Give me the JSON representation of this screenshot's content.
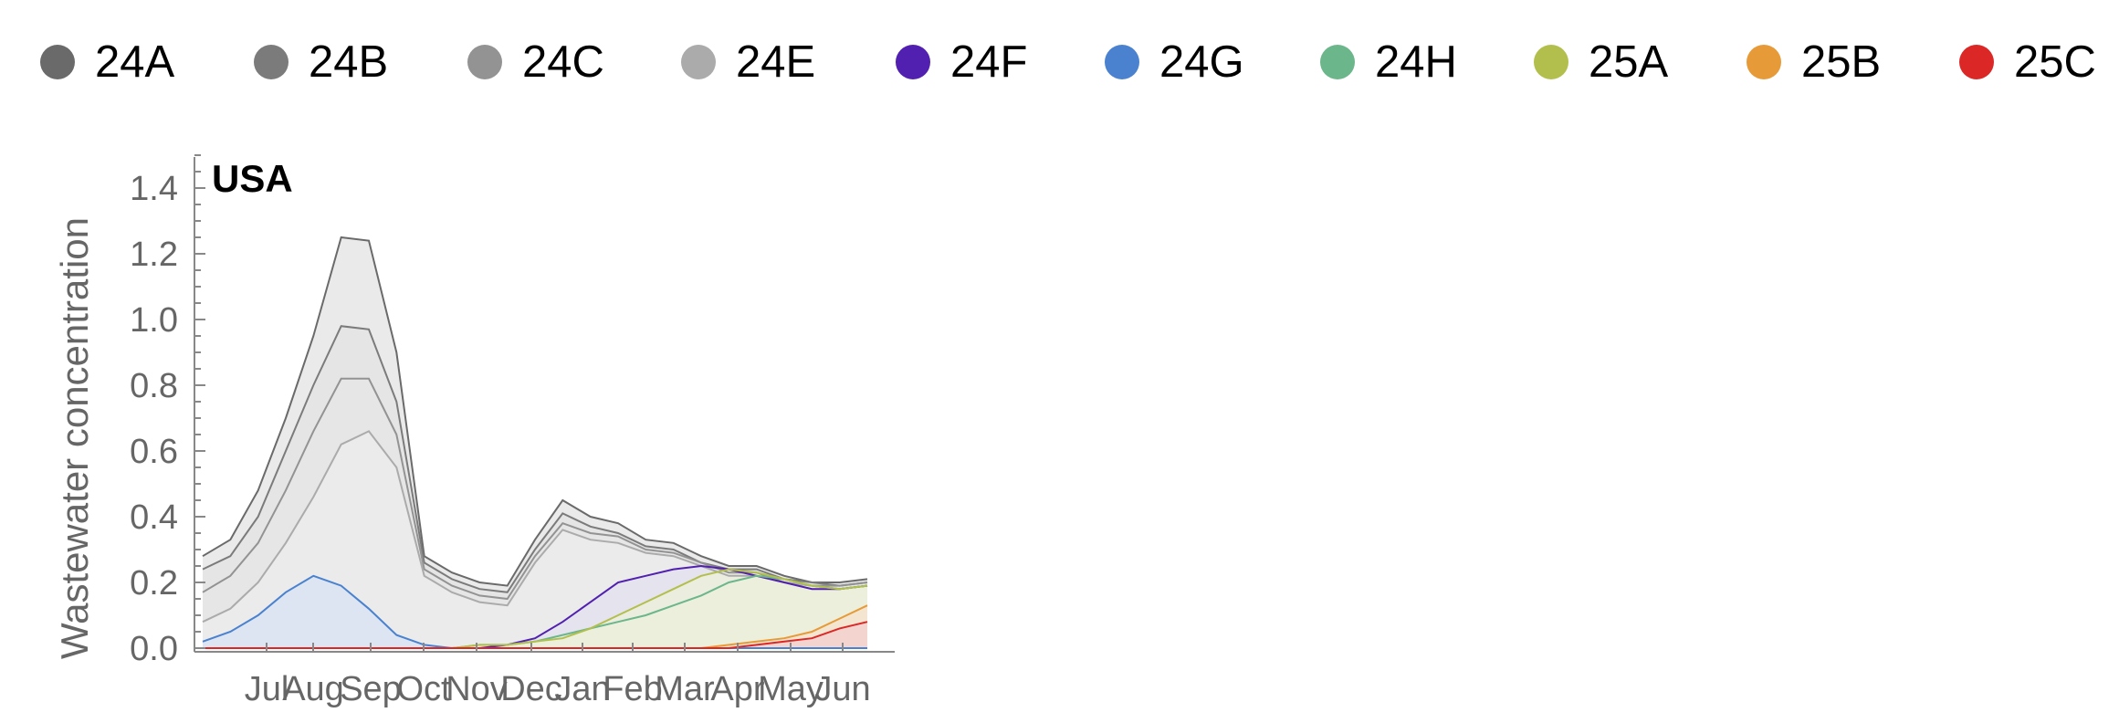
{
  "legend": {
    "items": [
      {
        "label": "24A",
        "color": "#6a6a6a"
      },
      {
        "label": "24B",
        "color": "#7b7b7b"
      },
      {
        "label": "24C",
        "color": "#939393"
      },
      {
        "label": "24E",
        "color": "#ababab"
      },
      {
        "label": "24F",
        "color": "#5120b0"
      },
      {
        "label": "24G",
        "color": "#4a82d0"
      },
      {
        "label": "24H",
        "color": "#6bb68a"
      },
      {
        "label": "25A",
        "color": "#b3bf4c"
      },
      {
        "label": "25B",
        "color": "#e79a38"
      },
      {
        "label": "25C",
        "color": "#dc2727"
      }
    ]
  },
  "chart_data": {
    "type": "area",
    "title": "USA",
    "xlabel": "",
    "ylabel": "Wastewater concentration",
    "ylim": [
      0,
      1.5
    ],
    "yticks": [
      "0.0",
      "0.2",
      "0.4",
      "0.6",
      "0.8",
      "1.0",
      "1.2",
      "1.4"
    ],
    "x_tick_labels": [
      "Jul",
      "Aug",
      "Sep",
      "Oct",
      "Nov",
      "Dec",
      "Jan",
      "Feb",
      "Mar",
      "Apr",
      "May",
      "Jun"
    ],
    "x": [
      "Jun 15",
      "Jul 1",
      "Jul 15",
      "Aug 1",
      "Aug 15",
      "Sep 1",
      "Sep 15",
      "Oct 1",
      "Oct 15",
      "Nov 1",
      "Nov 15",
      "Dec 1",
      "Dec 15",
      "Jan 1",
      "Jan 15",
      "Feb 1",
      "Feb 15",
      "Mar 1",
      "Mar 15",
      "Apr 1",
      "Apr 15",
      "May 1",
      "May 15",
      "Jun 1",
      "Jun 10"
    ],
    "series": [
      {
        "name": "24A",
        "values": [
          0.28,
          0.33,
          0.48,
          0.7,
          0.95,
          1.25,
          1.24,
          0.9,
          0.28,
          0.23,
          0.2,
          0.19,
          0.33,
          0.45,
          0.4,
          0.38,
          0.33,
          0.32,
          0.28,
          0.25,
          0.25,
          0.22,
          0.2,
          0.2,
          0.21
        ]
      },
      {
        "name": "24B",
        "values": [
          0.24,
          0.28,
          0.4,
          0.6,
          0.8,
          0.98,
          0.97,
          0.75,
          0.26,
          0.21,
          0.18,
          0.17,
          0.3,
          0.41,
          0.37,
          0.35,
          0.31,
          0.3,
          0.26,
          0.24,
          0.24,
          0.21,
          0.2,
          0.19,
          0.2
        ]
      },
      {
        "name": "24C",
        "values": [
          0.17,
          0.22,
          0.32,
          0.48,
          0.66,
          0.82,
          0.82,
          0.65,
          0.24,
          0.19,
          0.16,
          0.15,
          0.28,
          0.38,
          0.35,
          0.34,
          0.3,
          0.29,
          0.26,
          0.23,
          0.23,
          0.2,
          0.19,
          0.19,
          0.2
        ]
      },
      {
        "name": "24E",
        "values": [
          0.08,
          0.12,
          0.2,
          0.32,
          0.46,
          0.62,
          0.66,
          0.55,
          0.22,
          0.17,
          0.14,
          0.13,
          0.26,
          0.36,
          0.33,
          0.32,
          0.29,
          0.28,
          0.25,
          0.22,
          0.22,
          0.2,
          0.19,
          0.18,
          0.19
        ]
      },
      {
        "name": "24F",
        "values": [
          0.0,
          0.0,
          0.0,
          0.0,
          0.0,
          0.0,
          0.0,
          0.0,
          0.0,
          0.0,
          0.0,
          0.01,
          0.03,
          0.08,
          0.14,
          0.2,
          0.22,
          0.24,
          0.25,
          0.24,
          0.22,
          0.2,
          0.18,
          0.18,
          0.19
        ]
      },
      {
        "name": "24G",
        "values": [
          0.02,
          0.05,
          0.1,
          0.17,
          0.22,
          0.19,
          0.12,
          0.04,
          0.01,
          0.0,
          0.0,
          0.0,
          0.0,
          0.0,
          0.0,
          0.0,
          0.0,
          0.0,
          0.0,
          0.0,
          0.0,
          0.0,
          0.0,
          0.0,
          0.0
        ]
      },
      {
        "name": "24H",
        "values": [
          0.0,
          0.0,
          0.0,
          0.0,
          0.0,
          0.0,
          0.0,
          0.0,
          0.0,
          0.0,
          0.01,
          0.01,
          0.02,
          0.04,
          0.06,
          0.08,
          0.1,
          0.13,
          0.16,
          0.2,
          0.22,
          0.21,
          0.19,
          0.18,
          0.19
        ]
      },
      {
        "name": "25A",
        "values": [
          0.0,
          0.0,
          0.0,
          0.0,
          0.0,
          0.0,
          0.0,
          0.0,
          0.0,
          0.0,
          0.01,
          0.01,
          0.02,
          0.03,
          0.06,
          0.1,
          0.14,
          0.18,
          0.22,
          0.24,
          0.23,
          0.21,
          0.19,
          0.18,
          0.19
        ]
      },
      {
        "name": "25B",
        "values": [
          0.0,
          0.0,
          0.0,
          0.0,
          0.0,
          0.0,
          0.0,
          0.0,
          0.0,
          0.0,
          0.0,
          0.0,
          0.0,
          0.0,
          0.0,
          0.0,
          0.0,
          0.0,
          0.0,
          0.01,
          0.02,
          0.03,
          0.05,
          0.09,
          0.13
        ]
      },
      {
        "name": "25C",
        "values": [
          0.0,
          0.0,
          0.0,
          0.0,
          0.0,
          0.0,
          0.0,
          0.0,
          0.0,
          0.0,
          0.0,
          0.0,
          0.0,
          0.0,
          0.0,
          0.0,
          0.0,
          0.0,
          0.0,
          0.0,
          0.01,
          0.02,
          0.03,
          0.06,
          0.08
        ]
      }
    ],
    "grid": false,
    "legend_placement": "top"
  }
}
